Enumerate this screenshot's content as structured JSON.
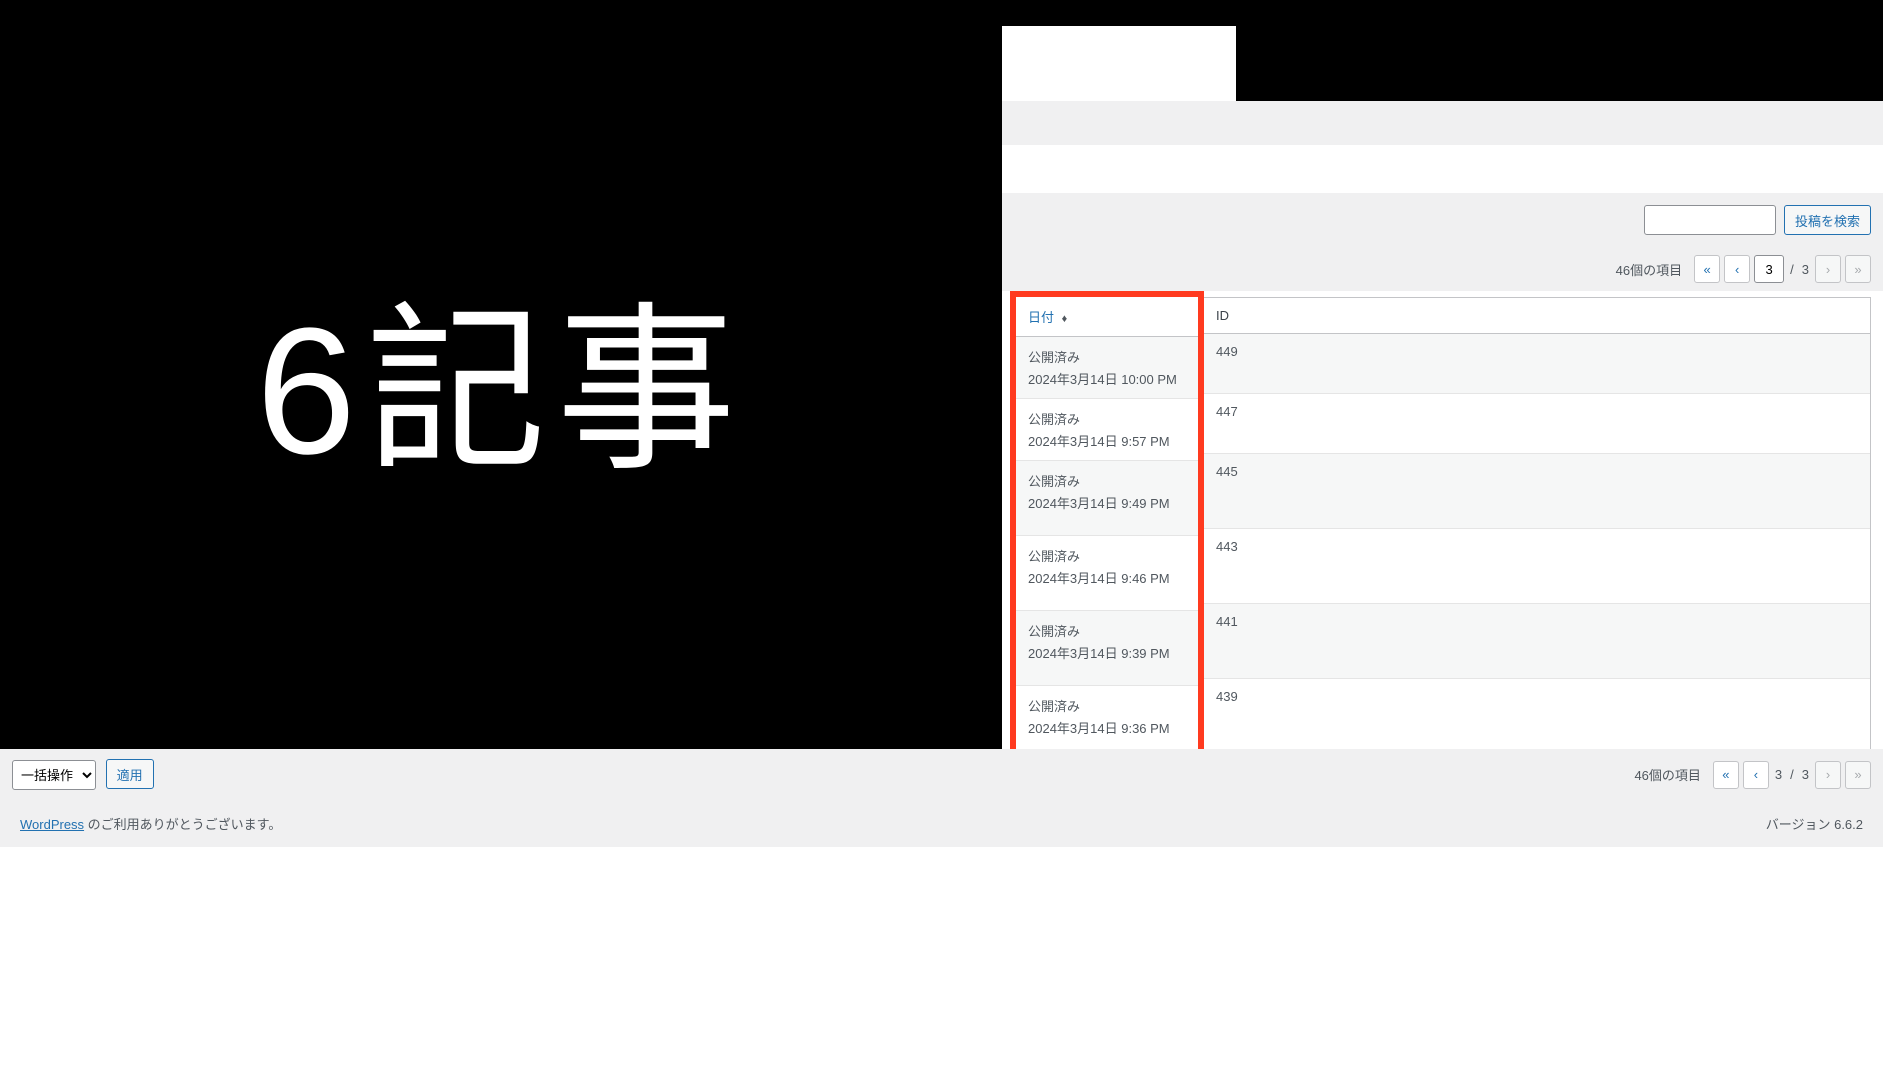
{
  "overlay": {
    "text": "6記事"
  },
  "search": {
    "placeholder": "",
    "value": "",
    "button": "投稿を検索"
  },
  "pagination": {
    "items_count": "46個の項目",
    "first": "«",
    "prev": "‹",
    "current_page": "3",
    "total_pages": "3",
    "separator": "/",
    "next": "›",
    "last": "»"
  },
  "table": {
    "headers": {
      "date": "日付",
      "id": "ID"
    },
    "status_label": "公開済み",
    "rows": [
      {
        "date": "2024年3月14日 10:00 PM",
        "id": "449"
      },
      {
        "date": "2024年3月14日 9:57 PM",
        "id": "447"
      },
      {
        "date": "2024年3月14日 9:49 PM",
        "id": "445"
      },
      {
        "date": "2024年3月14日 9:46 PM",
        "id": "443"
      },
      {
        "date": "2024年3月14日 9:39 PM",
        "id": "441"
      },
      {
        "date": "2024年3月14日 9:36 PM",
        "id": "439"
      }
    ]
  },
  "bulk": {
    "select_label": "一括操作",
    "apply": "適用"
  },
  "footer": {
    "wordpress": "WordPress",
    "thanks": " のご利用ありがとうございます。",
    "version": "バージョン 6.6.2"
  }
}
